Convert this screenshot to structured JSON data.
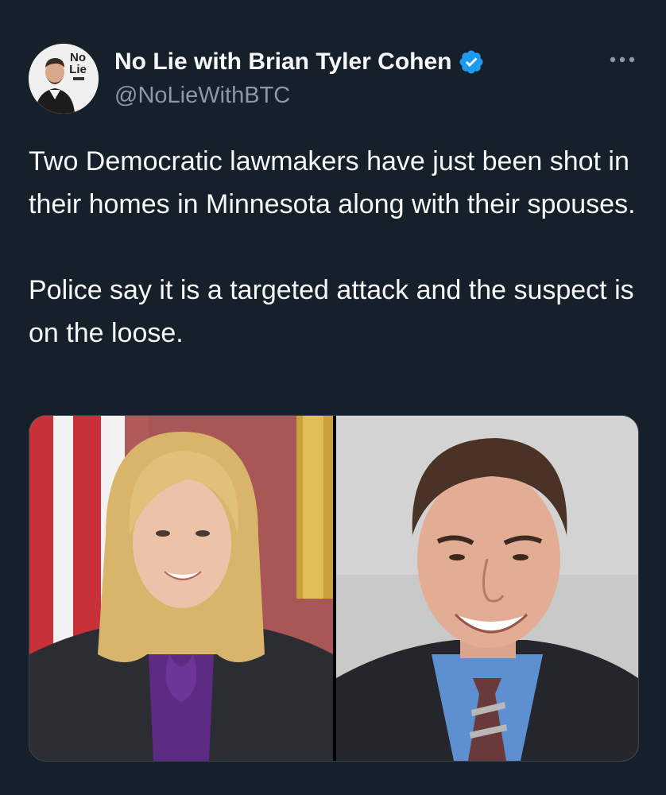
{
  "author": {
    "display_name": "No Lie with Brian Tyler Cohen",
    "handle": "@NoLieWithBTC",
    "avatar_logo_text": [
      "No",
      "Lie"
    ],
    "verified": true
  },
  "tweet": {
    "paragraphs": [
      "Two Democratic lawmakers have just been shot in their homes in Minnesota along with their spouses.",
      "Police say it is a targeted attack and the suspect is on the loose."
    ]
  },
  "media": {
    "photos": [
      {
        "subject": "woman with blonde hair in dark suit and purple blouse, flag background"
      },
      {
        "subject": "man in dark pinstripe suit with blue shirt and striped tie, grey background"
      }
    ]
  },
  "colors": {
    "background": "#15202b",
    "text_primary": "#f7f9f9",
    "text_secondary": "#8b98a5",
    "verified_blue": "#1d9bf0",
    "border": "#38444d"
  },
  "icons": {
    "verified": "verified-badge-icon",
    "more": "more-options-icon"
  }
}
